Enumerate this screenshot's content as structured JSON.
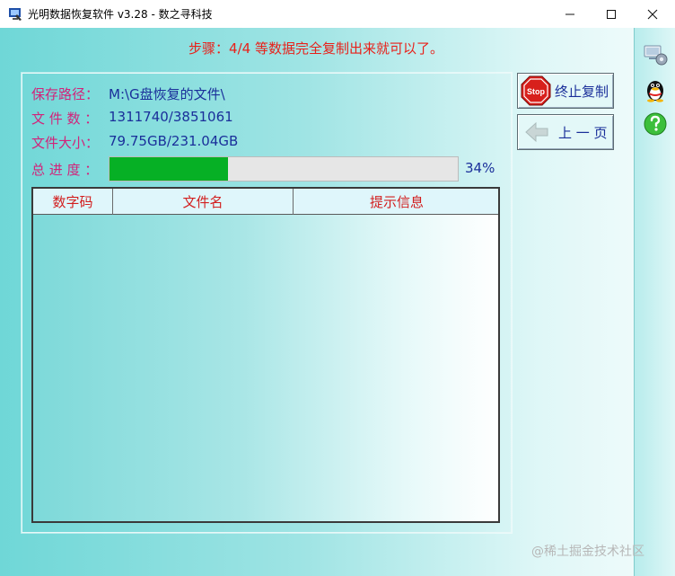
{
  "window": {
    "title": "光明数据恢复软件 v3.28 - 数之寻科技"
  },
  "step": {
    "text": "步骤：4/4 等数据完全复制出来就可以了。"
  },
  "info": {
    "save_path_label": "保存路径：",
    "save_path_value": "M:\\G盘恢复的文件\\",
    "file_count_label": "文 件 数 ：",
    "file_count_value": "1311740/3851061",
    "file_size_label": "文件大小：",
    "file_size_value": "79.75GB/231.04GB",
    "progress_label": "总 进 度 ：",
    "progress_text": "34%",
    "progress_value": 0.34
  },
  "table": {
    "columns": [
      "数字码",
      "文件名",
      "提示信息"
    ],
    "rows": []
  },
  "buttons": {
    "stop_label": "终止复制",
    "stop_icon_text": "Stop",
    "back_label": "上 一 页"
  },
  "sidebar_icons": [
    "network-settings-icon",
    "qq-icon",
    "help-icon"
  ],
  "watermark": "@稀土掘金技术社区",
  "colors": {
    "step_text": "#e8211a",
    "label": "#d2237a",
    "value": "#1a2f9a",
    "progress": "#06b025",
    "header_text": "#d21e1e"
  }
}
